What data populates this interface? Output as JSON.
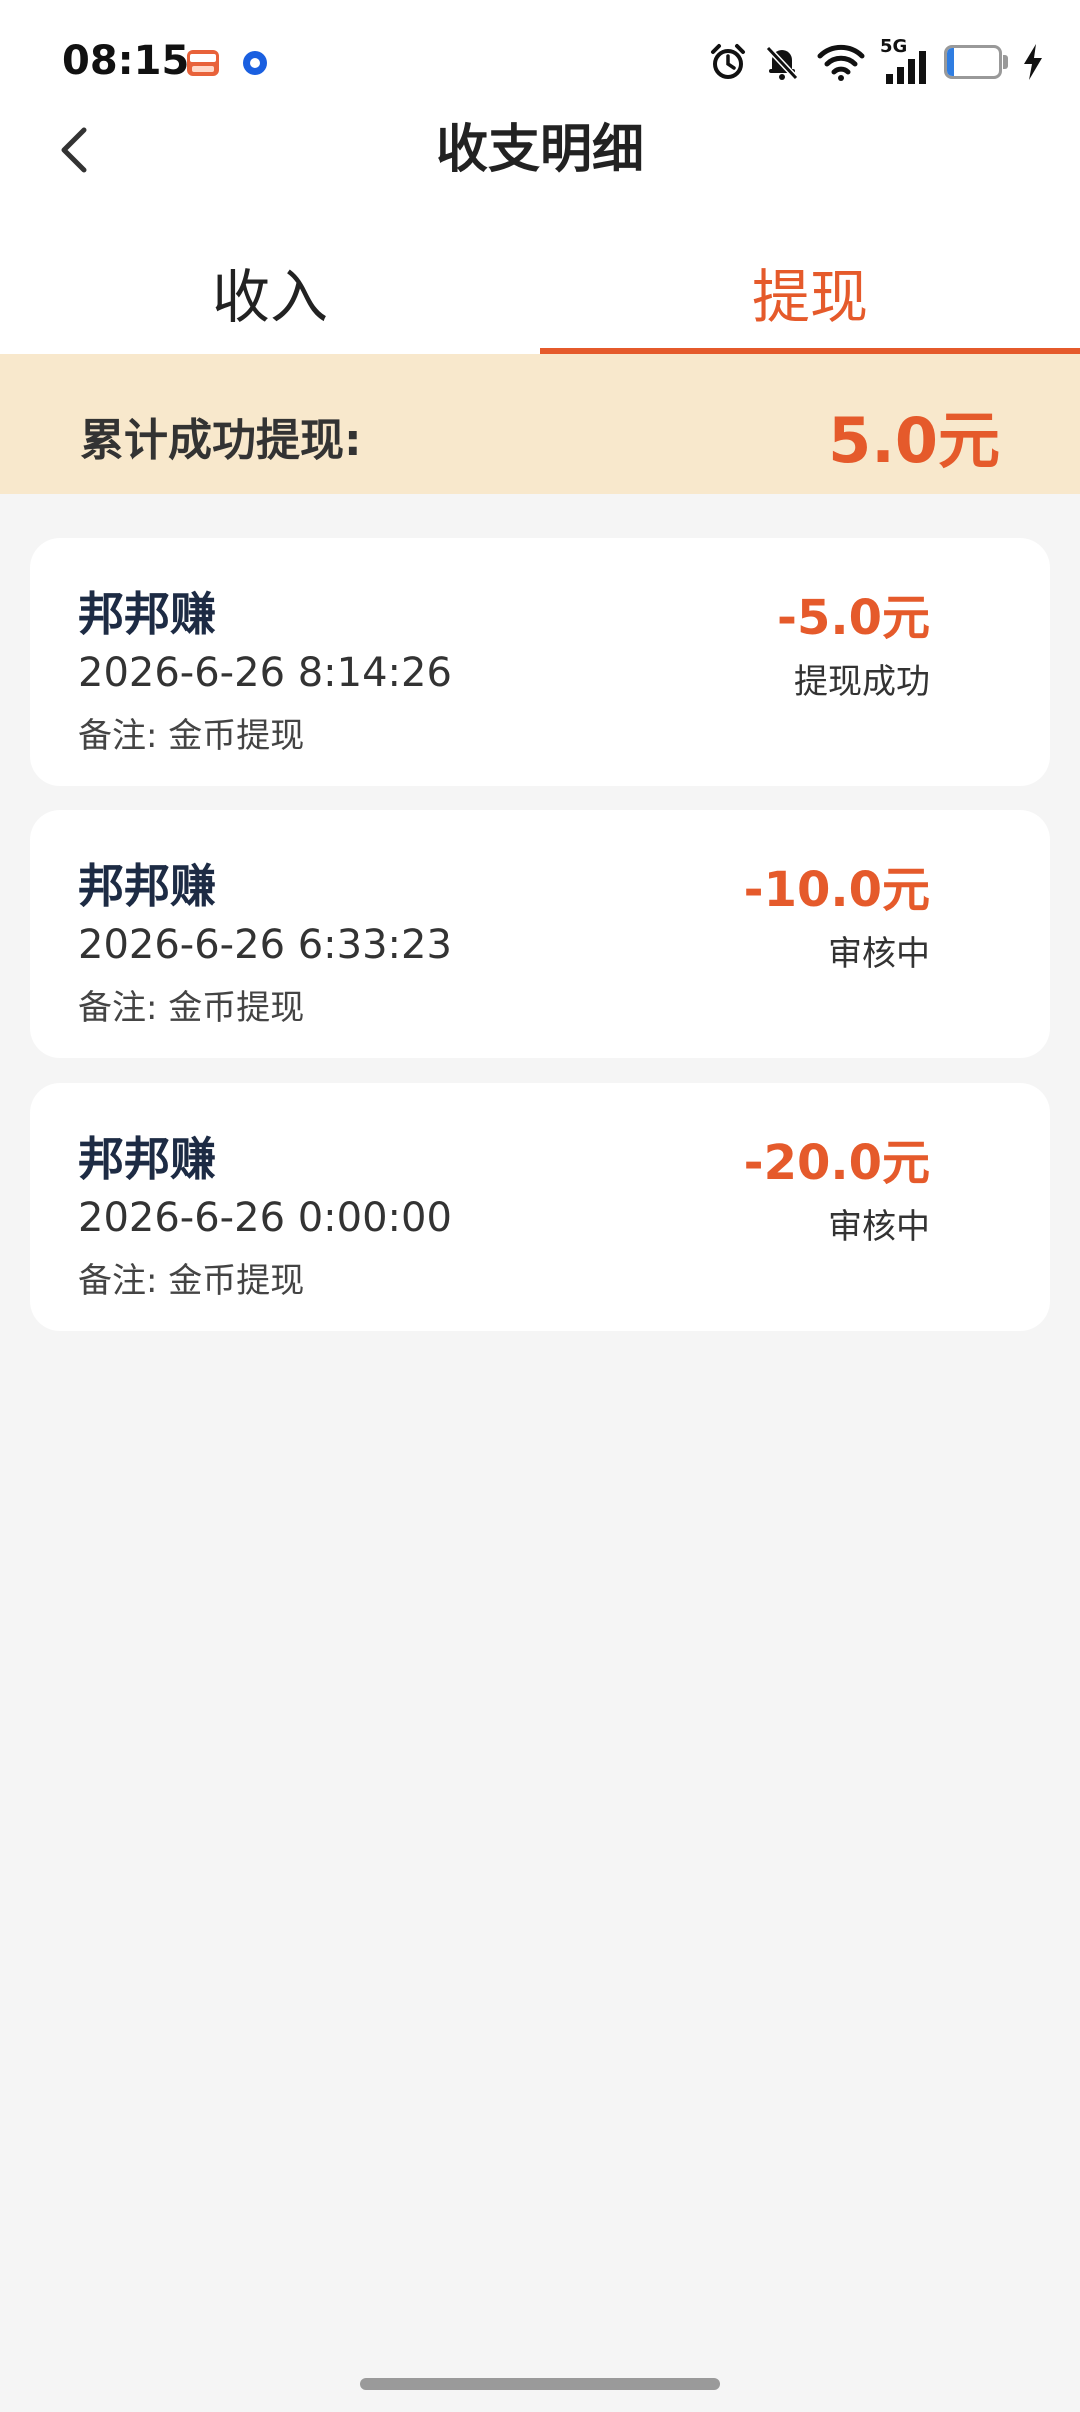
{
  "status_bar": {
    "time": "08:15",
    "signal_label": "5G",
    "battery_level": "13",
    "battery_fraction": 0.13,
    "icons": [
      "oppo-app-icon",
      "blue-app-icon",
      "alarm-icon",
      "bell-muted-icon",
      "wifi-icon",
      "cellular-5g-icon",
      "battery-icon",
      "charging-icon"
    ]
  },
  "header": {
    "title": "收支明细",
    "back_icon": "chevron-left-icon"
  },
  "tabs": [
    {
      "label": "收入",
      "active": false
    },
    {
      "label": "提现",
      "active": true
    }
  ],
  "summary": {
    "label": "累计成功提现:",
    "value": "5.0元"
  },
  "records": [
    {
      "name": "邦邦赚",
      "time": "2026-6-26 8:14:26",
      "note": "备注: 金币提现",
      "amount": "-5.0元",
      "status": "提现成功"
    },
    {
      "name": "邦邦赚",
      "time": "2026-6-26 6:33:23",
      "note": "备注: 金币提现",
      "amount": "-10.0元",
      "status": "审核中"
    },
    {
      "name": "邦邦赚",
      "time": "2026-6-26 0:00:00",
      "note": "备注: 金币提现",
      "amount": "-20.0元",
      "status": "审核中"
    }
  ],
  "colors": {
    "accent": "#e55a2b",
    "summary_bg": "#f8e8cc",
    "page_bg": "#f5f5f5",
    "name_text": "#1d2b44"
  }
}
